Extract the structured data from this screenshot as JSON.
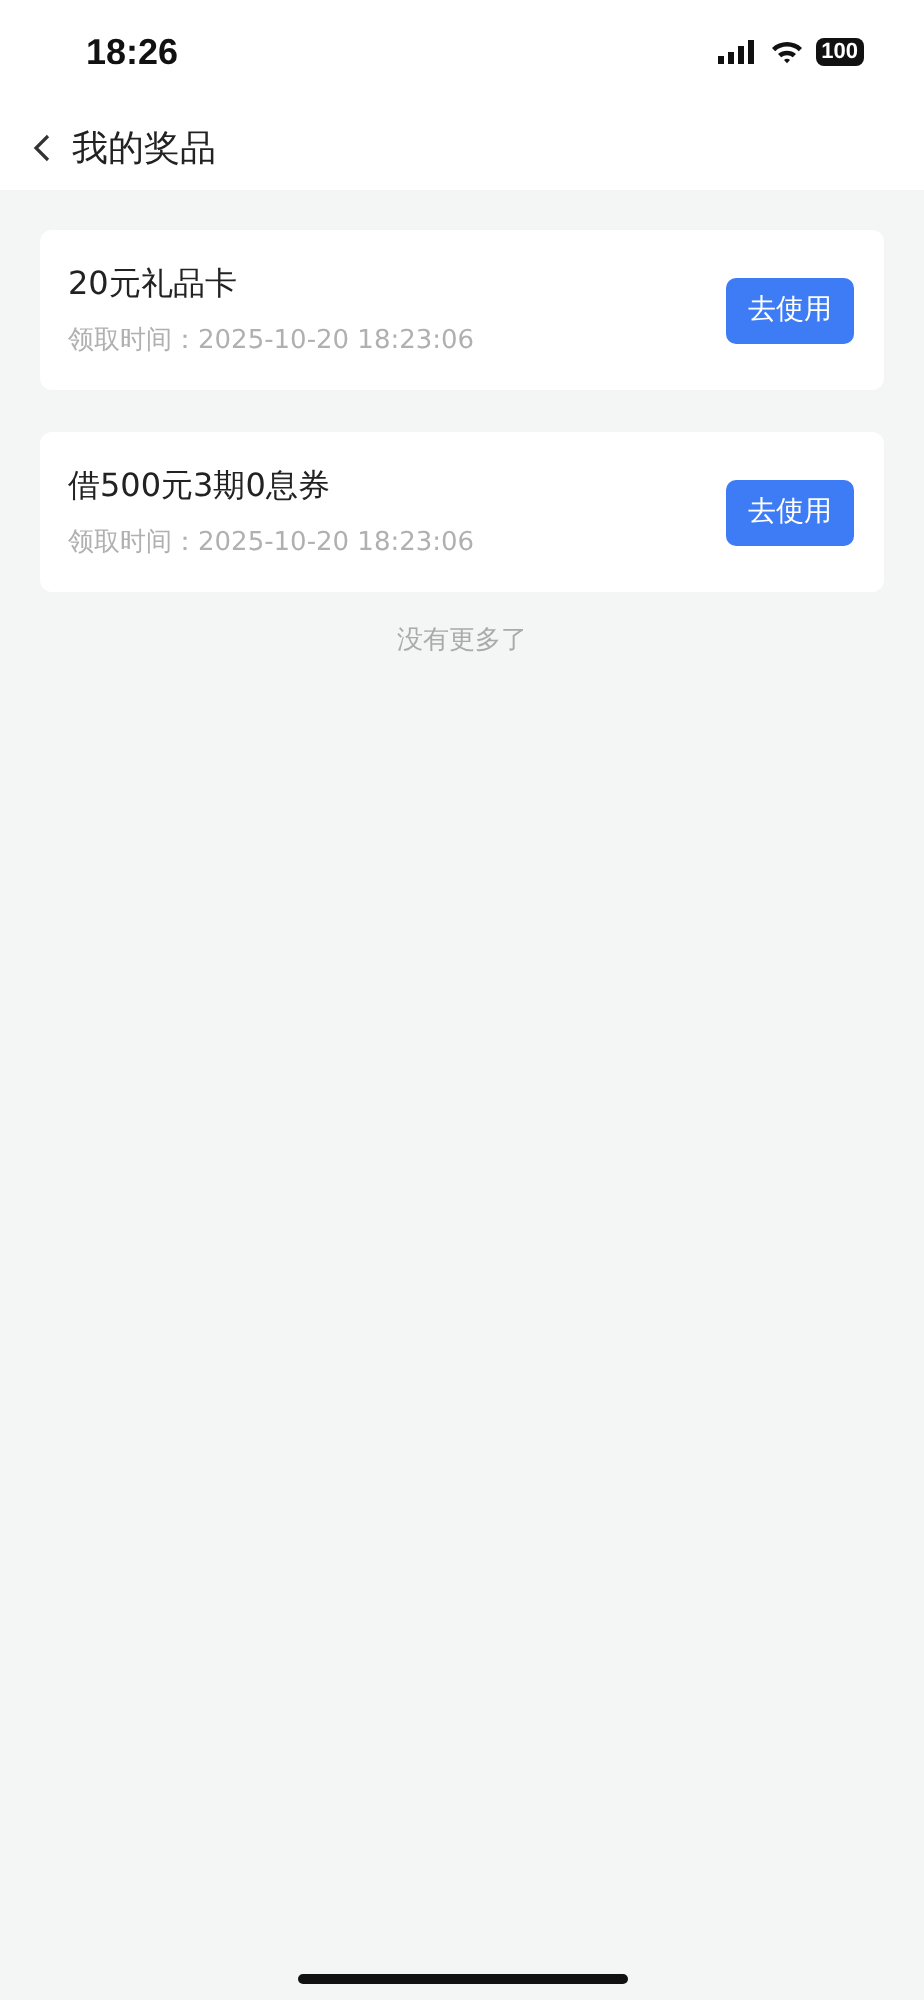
{
  "status_bar": {
    "time": "18:26",
    "battery": "100"
  },
  "nav": {
    "title": "我的奖品"
  },
  "prizes": [
    {
      "name": "20元礼品卡",
      "claimed_label": "领取时间：",
      "claimed_time": "2025-10-20 18:23:06",
      "action": "去使用"
    },
    {
      "name": "借500元3期0息券",
      "claimed_label": "领取时间：",
      "claimed_time": "2025-10-20 18:23:06",
      "action": "去使用"
    }
  ],
  "end_note": "没有更多了"
}
